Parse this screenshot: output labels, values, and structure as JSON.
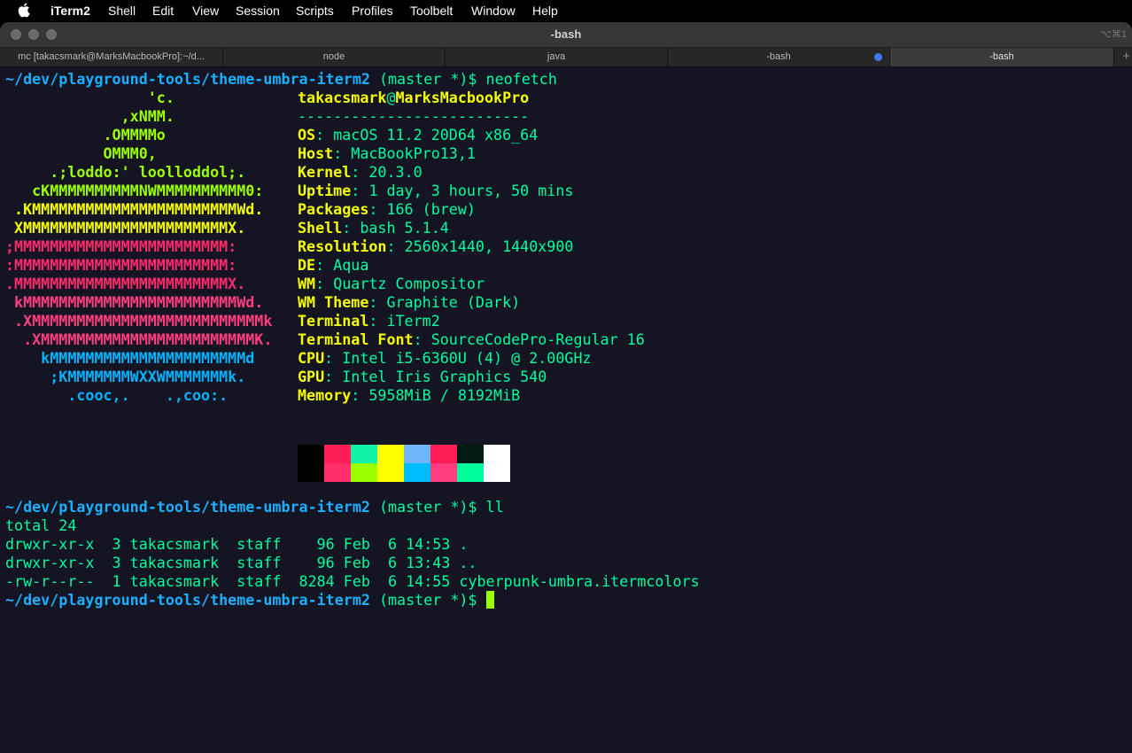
{
  "menubar": {
    "items": [
      "iTerm2",
      "Shell",
      "Edit",
      "View",
      "Session",
      "Scripts",
      "Profiles",
      "Toolbelt",
      "Window",
      "Help"
    ]
  },
  "window": {
    "title": "-bash",
    "shortcut": "⌥⌘1",
    "tabs": [
      {
        "label": "mc [takacsmark@MarksMacbookPro]:~/d..."
      },
      {
        "label": "node"
      },
      {
        "label": "java"
      },
      {
        "label": "-bash"
      },
      {
        "label": "-bash"
      }
    ],
    "new_tab": "+"
  },
  "terminal": {
    "prompt_path": "~/dev/playground-tools/theme-umbra-iterm2",
    "prompt_branch": " (master *)$ ",
    "cmd1": "neofetch",
    "cmd2": "ll",
    "art": [
      "                'c.",
      "             ,xNMM.",
      "           .OMMMMo",
      "           OMMM0,",
      "     .;loddo:' loolloddol;.",
      "   cKMMMMMMMMMMNWMMMMMMMMMM0:",
      " .KMMMMMMMMMMMMMMMMMMMMMMMWd.",
      " XMMMMMMMMMMMMMMMMMMMMMMMX.",
      ";MMMMMMMMMMMMMMMMMMMMMMMM:",
      ":MMMMMMMMMMMMMMMMMMMMMMMM:",
      ".MMMMMMMMMMMMMMMMMMMMMMMMX.",
      " kMMMMMMMMMMMMMMMMMMMMMMMMWd.",
      " .XMMMMMMMMMMMMMMMMMMMMMMMMMMk",
      "  .XMMMMMMMMMMMMMMMMMMMMMMMMK.",
      "    kMMMMMMMMMMMMMMMMMMMMMMd",
      "     ;KMMMMMMMWXXWMMMMMMMk.",
      "       .cooc,.    .,coo:."
    ],
    "user": "takacsmark",
    "at": "@",
    "host": "MarksMacbookPro",
    "separator": "--------------------------",
    "info": [
      {
        "key": "OS",
        "value": "macOS 11.2 20D64 x86_64"
      },
      {
        "key": "Host",
        "value": "MacBookPro13,1"
      },
      {
        "key": "Kernel",
        "value": "20.3.0"
      },
      {
        "key": "Uptime",
        "value": "1 day, 3 hours, 50 mins"
      },
      {
        "key": "Packages",
        "value": "166 (brew)"
      },
      {
        "key": "Shell",
        "value": "bash 5.1.4"
      },
      {
        "key": "Resolution",
        "value": "2560x1440, 1440x900"
      },
      {
        "key": "DE",
        "value": "Aqua"
      },
      {
        "key": "WM",
        "value": "Quartz Compositor"
      },
      {
        "key": "WM Theme",
        "value": "Graphite (Dark)"
      },
      {
        "key": "Terminal",
        "value": "iTerm2"
      },
      {
        "key": "Terminal Font",
        "value": "SourceCodePro-Regular 16"
      },
      {
        "key": "CPU",
        "value": "Intel i5-6360U (4) @ 2.00GHz"
      },
      {
        "key": "GPU",
        "value": "Intel Iris Graphics 540"
      },
      {
        "key": "Memory",
        "value": "5958MiB / 8192MiB"
      }
    ],
    "palette_colors": {
      "top": [
        "#000000",
        "#ff1d58",
        "#10f2a8",
        "#ffff00",
        "#72b4fa",
        "#ff1d58",
        "#001a14",
        "#ffffff"
      ],
      "bottom": [
        "#000000",
        "#ff2f6b",
        "#9bff00",
        "#ffff00",
        "#00bbff",
        "#ff3d7f",
        "#00ff9c",
        "#ffffff"
      ]
    },
    "ls_output": [
      "total 24",
      "drwxr-xr-x  3 takacsmark  staff    96 Feb  6 14:53 .",
      "drwxr-xr-x  3 takacsmark  staff    96 Feb  6 13:43 ..",
      "-rw-r--r--  1 takacsmark  staff  8284 Feb  6 14:55 cyberpunk-umbra.itermcolors"
    ]
  }
}
